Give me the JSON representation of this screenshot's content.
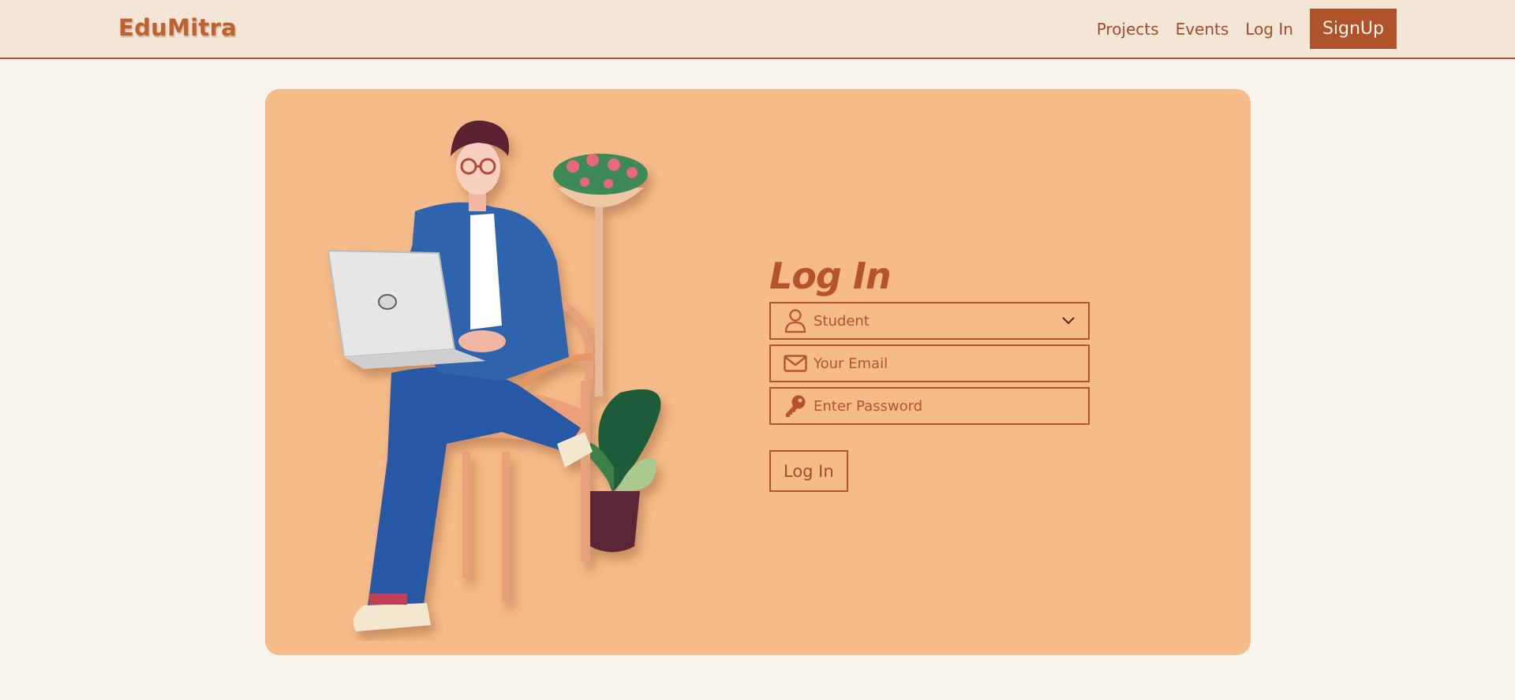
{
  "navbar": {
    "brand": "EduMitra",
    "links": [
      "Projects",
      "Events",
      "Log In"
    ],
    "signup_label": "SignUp"
  },
  "login_form": {
    "title": "Log In",
    "role_select": {
      "selected": "Student"
    },
    "email": {
      "placeholder": "Your Email"
    },
    "password": {
      "placeholder": "Enter Password"
    },
    "submit_label": "Log In"
  },
  "icons": {
    "role": "user-icon",
    "email": "envelope-icon",
    "password": "key-icon",
    "dropdown": "chevron-down-icon"
  },
  "colors": {
    "page_bg": "#f9f4ee",
    "navbar_bg": "#f4e6d6",
    "accent": "#b5532a",
    "card_bg": "#f5bb88",
    "signup_bg": "#b0532b"
  }
}
